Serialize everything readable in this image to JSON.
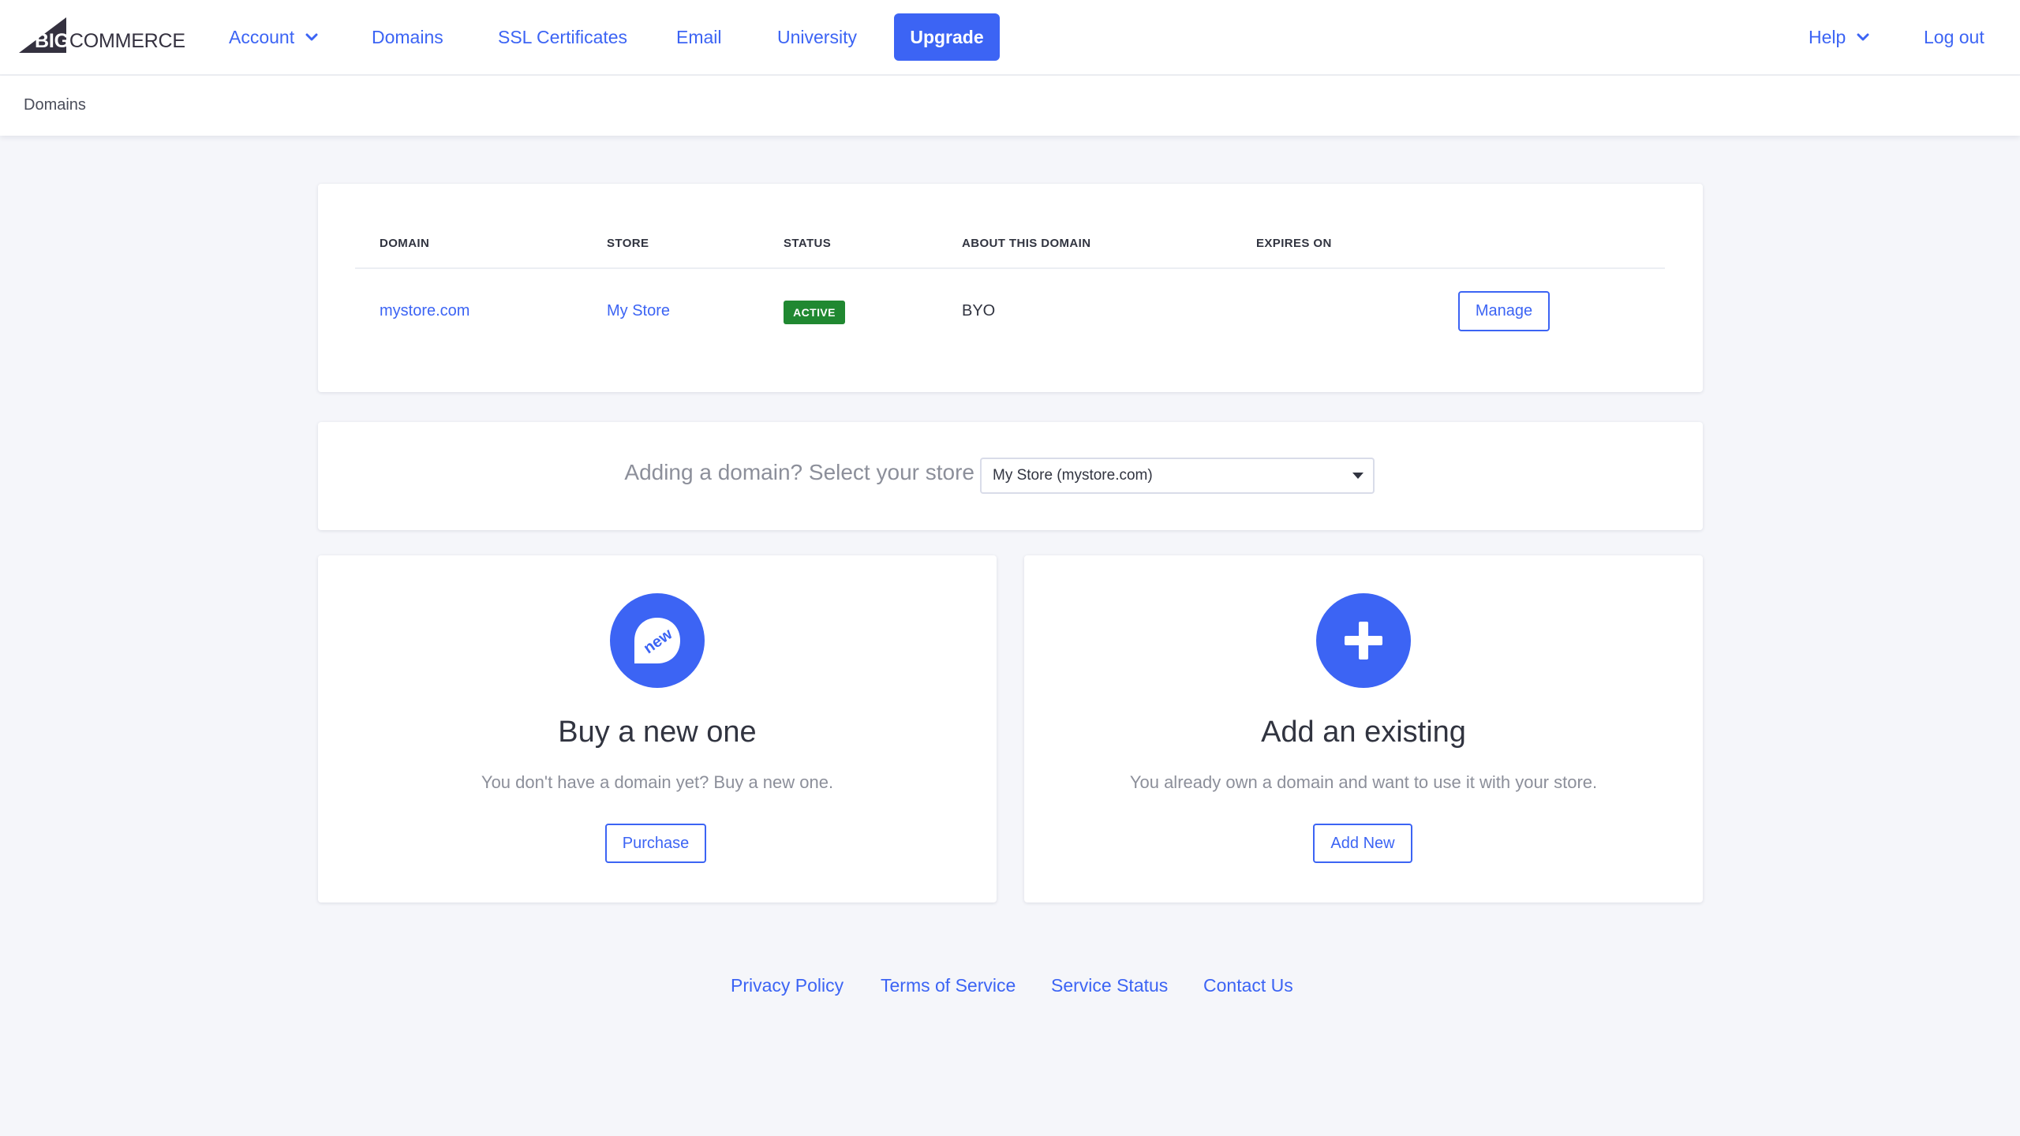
{
  "brand": {
    "logo_text_bold": "BIG",
    "logo_text_rest": "COMMERCE",
    "accent_color": "#3c64f4",
    "success_color": "#208831"
  },
  "nav": {
    "account": "Account",
    "domains": "Domains",
    "ssl": "SSL Certificates",
    "email": "Email",
    "university": "University",
    "upgrade": "Upgrade",
    "help": "Help",
    "logout": "Log out"
  },
  "breadcrumb": "Domains",
  "domains_table": {
    "headers": [
      "DOMAIN",
      "STORE",
      "STATUS",
      "ABOUT THIS DOMAIN",
      "EXPIRES ON"
    ],
    "rows": [
      {
        "domain": "mystore.com",
        "store": "My Store",
        "status": "ACTIVE",
        "about": "BYO",
        "expires": "",
        "action": "Manage"
      }
    ]
  },
  "store_selector": {
    "label": "Adding a domain? Select your store",
    "selected": "My Store (mystore.com)"
  },
  "options": {
    "buy": {
      "icon": "new-tag-icon",
      "icon_text": "new",
      "title": "Buy a new one",
      "description": "You don't have a domain yet? Buy a new one.",
      "button": "Purchase"
    },
    "add": {
      "icon": "plus-icon",
      "title": "Add an existing",
      "description": "You already own a domain and want to use it with your store.",
      "button": "Add New"
    }
  },
  "footer": {
    "privacy": "Privacy Policy",
    "terms": "Terms of Service",
    "status": "Service Status",
    "contact": "Contact Us"
  }
}
